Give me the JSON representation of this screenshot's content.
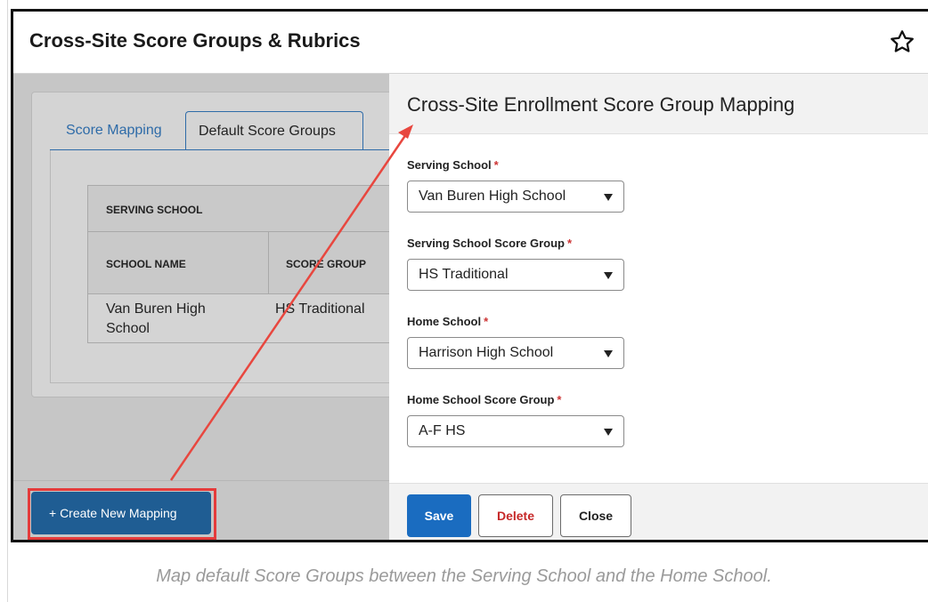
{
  "window": {
    "title": "Cross-Site Score Groups & Rubrics",
    "star_icon": "star-outline-icon"
  },
  "tabs": [
    {
      "label": "Score Mapping",
      "active": false
    },
    {
      "label": "Default Score Groups",
      "active": true
    }
  ],
  "grid": {
    "group_header": "SERVING SCHOOL",
    "columns": [
      "SCHOOL NAME",
      "SCORE GROUP"
    ],
    "rows": [
      {
        "school_name": "Van Buren High School",
        "score_group": "HS Traditional"
      }
    ]
  },
  "create_button": {
    "label": "+ Create New Mapping"
  },
  "panel": {
    "title": "Cross-Site Enrollment Score Group Mapping",
    "fields": [
      {
        "label": "Serving School",
        "required": "*",
        "value": "Van Buren High School"
      },
      {
        "label": "Serving School Score Group",
        "required": "*",
        "value": "HS Traditional"
      },
      {
        "label": "Home School",
        "required": "*",
        "value": "Harrison High School"
      },
      {
        "label": "Home School Score Group",
        "required": "*",
        "value": "A-F HS"
      }
    ],
    "buttons": {
      "save": "Save",
      "delete": "Delete",
      "close": "Close"
    }
  },
  "caption": "Map default Score Groups between the Serving School and the Home School.",
  "colors": {
    "primary": "#1a6cc0",
    "create_button": "#1f5d93",
    "delete_text": "#c62828",
    "annotation": "#e53b3b",
    "link": "#2e6ba8"
  }
}
